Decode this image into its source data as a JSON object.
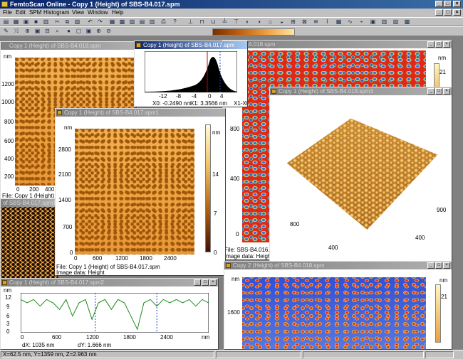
{
  "app": {
    "title": "FemtoScan Online - Copy 1 (Height) of SBS-B4.017.spm"
  },
  "menu": [
    "File",
    "Edit",
    "SPM",
    "Histogram",
    "View",
    "Window",
    "Help"
  ],
  "windows": {
    "topleft": {
      "title": "Copy 1 (Height) of SBS-B4.018.spm",
      "unit": "nm",
      "yticks": [
        "1200",
        "1000",
        "800",
        "600",
        "400",
        "200"
      ],
      "xticks": [
        "0",
        "200",
        "400"
      ],
      "truncated": "File: Copy 1 (Height) of SBS"
    },
    "histogram": {
      "title": "Copy 1 (Height) of SBS-B4.017.spm",
      "xticks": [
        "-12",
        "-8",
        "-4",
        "0",
        "4"
      ],
      "x1": "X0: -0.2490 nm",
      "x2": "X1: 3.3566 nm",
      "x3": "X1-X0"
    },
    "leftsmall": {
      "title": "of SBS-B4.017.spm1"
    },
    "main": {
      "title": "Copy 1 (Height) of SBS-B4.017.spm1",
      "unit": "nm",
      "yticks": [
        "2800",
        "2100",
        "1400",
        "700",
        "0"
      ],
      "xticks": [
        "0",
        "600",
        "1200",
        "1800",
        "2400"
      ],
      "cbar_ticks": [
        "14",
        "7",
        "0"
      ],
      "file": "File: Copy 1 (Height) of SBS-B4.017.spm",
      "imgdata": "Image data: Height"
    },
    "redmap": {
      "title": "SBS-B4.018.spm",
      "unit": "nm",
      "yticks": [
        "1200",
        "800",
        "400",
        "0"
      ],
      "cbar": "21",
      "file": "File: SBS-B4.016.spm",
      "imgdata": "Image data: Height"
    },
    "view3d": {
      "title": "Copy 1 (Height) of SBS-B4.018.spm3",
      "ticks": [
        "800",
        "400",
        "400",
        "900"
      ]
    },
    "profile": {
      "title": "Copy 1 (Height) of SBS-B4.017.spm2",
      "unit": "nm",
      "yticks": [
        "12",
        "9",
        "6",
        "3",
        "0"
      ],
      "xticks": [
        "0",
        "600",
        "1200",
        "1800",
        "2400"
      ],
      "xunit": "nm",
      "dx": "dX: 1035 nm",
      "dy": "dY: 1.666 nm"
    },
    "bluemap": {
      "title": "Copy 2 (Height) of SBS-B4.018.spm",
      "unit": "nm",
      "yticks": [
        "1600"
      ],
      "cbar": "21"
    }
  },
  "chart_data": {
    "type": "line",
    "title": "Copy 1 (Height) of SBS-B4.017.spm2",
    "xlabel": "nm",
    "ylabel": "nm",
    "xlim": [
      0,
      2900
    ],
    "ylim": [
      0,
      12
    ],
    "x": [
      0,
      100,
      200,
      300,
      400,
      500,
      600,
      700,
      800,
      900,
      1000,
      1100,
      1200,
      1300,
      1400,
      1500,
      1600,
      1700,
      1800,
      1900,
      2000,
      2100,
      2200,
      2300,
      2400,
      2500,
      2600,
      2700,
      2800,
      2900
    ],
    "series": [
      {
        "values": [
          10,
          9,
          10,
          8,
          10,
          9,
          7,
          10,
          5,
          9,
          10,
          4,
          9,
          10,
          7,
          10,
          9,
          5,
          1,
          9,
          10,
          8,
          10,
          9,
          10,
          9,
          10,
          8,
          10,
          9
        ]
      }
    ],
    "markers_x": [
      1150,
      2100
    ]
  },
  "status": {
    "coords": "X=62.5 nm, Y=1359 nm, Z=2.963 nm"
  }
}
